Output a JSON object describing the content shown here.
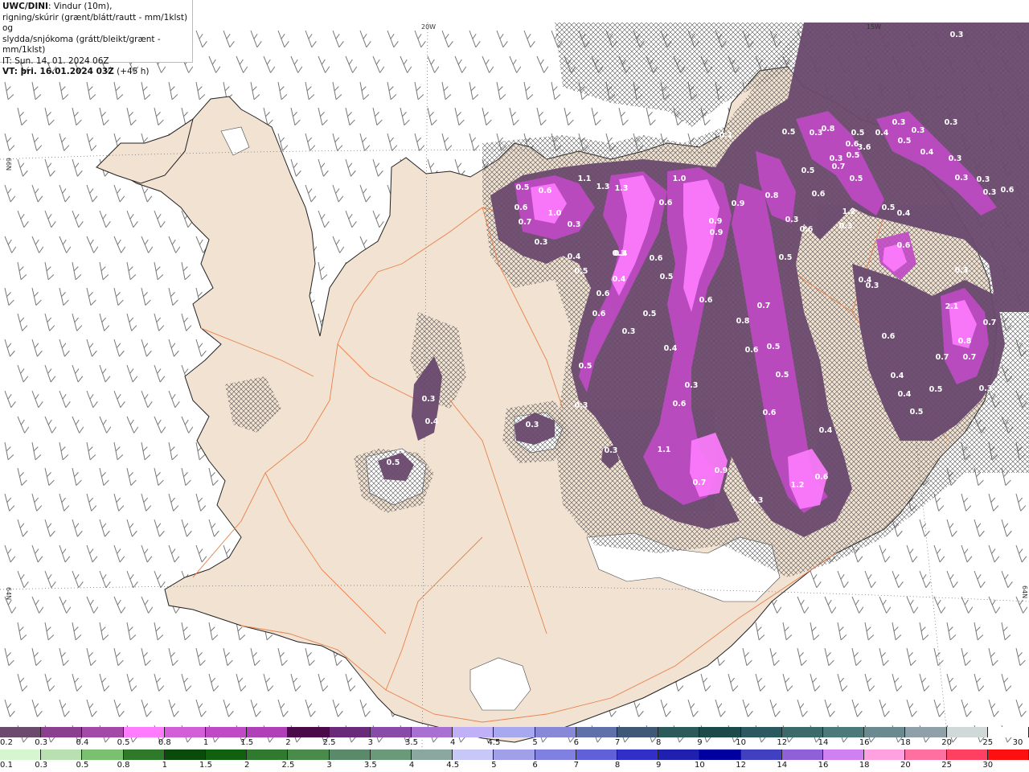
{
  "info": {
    "title_bold": "UWC/DINI",
    "title_rest": ": Vindur (10m),",
    "line2": "rigning/skúrir (grænt/blátt/rautt - mm/1klst) og",
    "line3": "slydda/snjókoma (grátt/bleikt/grænt - mm/1klst)",
    "it_line": "IT: Sun. 14. 01. 2024 06Z",
    "vt_label": "VT",
    "vt_value": ": þri. 16.01.2024 03Z",
    "vt_offset": " (+45 h)"
  },
  "grid_labels": {
    "lon_20w": "20W",
    "lon_15w": "15W",
    "lat_66n_left": "66N",
    "lat_64n_left": "64N",
    "lat_64n_right": "64N"
  },
  "snow_values": [
    {
      "v": "0.3"
    },
    {
      "v": "0.4"
    },
    {
      "v": "0.3"
    },
    {
      "v": "0.5"
    },
    {
      "v": "0.3"
    },
    {
      "v": "0.5"
    },
    {
      "v": "0.4"
    },
    {
      "v": "0.3"
    },
    {
      "v": "0.5"
    },
    {
      "v": "0.6"
    },
    {
      "v": "0.6"
    },
    {
      "v": "1.0"
    },
    {
      "v": "0.7"
    },
    {
      "v": "0.3"
    },
    {
      "v": "0.3"
    },
    {
      "v": "0.5"
    },
    {
      "v": "0.3"
    },
    {
      "v": "1.1"
    },
    {
      "v": "1.3"
    },
    {
      "v": "1.3"
    },
    {
      "v": "1.0"
    },
    {
      "v": "0.6"
    },
    {
      "v": "0.9"
    },
    {
      "v": "0.9"
    },
    {
      "v": "0.4"
    },
    {
      "v": "0.4"
    },
    {
      "v": "0.6"
    },
    {
      "v": "0.6"
    },
    {
      "v": "0.5"
    },
    {
      "v": "0.6"
    },
    {
      "v": "0.3"
    },
    {
      "v": "0.5"
    },
    {
      "v": "0.4"
    },
    {
      "v": "0.6"
    },
    {
      "v": "0.6"
    },
    {
      "v": "0.8"
    },
    {
      "v": "0.6"
    },
    {
      "v": "0.5"
    },
    {
      "v": "0.7"
    },
    {
      "v": "0.5"
    },
    {
      "v": "0.3"
    },
    {
      "v": "1.1"
    },
    {
      "v": "0.7"
    },
    {
      "v": "0.9"
    },
    {
      "v": "0.3"
    },
    {
      "v": "0.6"
    },
    {
      "v": "0.4"
    },
    {
      "v": "1.2"
    },
    {
      "v": "0.6"
    },
    {
      "v": "0.9"
    },
    {
      "v": "0.8"
    },
    {
      "v": "0.3"
    },
    {
      "v": "0.5"
    },
    {
      "v": "0.5"
    },
    {
      "v": "0.6"
    },
    {
      "v": "0.6"
    },
    {
      "v": "1.2"
    },
    {
      "v": "0.3"
    },
    {
      "v": "0.5"
    },
    {
      "v": "0.6"
    },
    {
      "v": "0.5"
    },
    {
      "v": "0.4"
    },
    {
      "v": "0.3"
    },
    {
      "v": "0.5"
    },
    {
      "v": "3.6"
    },
    {
      "v": "0.5"
    },
    {
      "v": "0.4"
    },
    {
      "v": "0.4"
    },
    {
      "v": "0.3"
    },
    {
      "v": "0.3"
    },
    {
      "v": "0.3"
    },
    {
      "v": "0.3"
    },
    {
      "v": "0.3"
    },
    {
      "v": "0.3"
    },
    {
      "v": "0.6"
    },
    {
      "v": "0.1"
    },
    {
      "v": "0.3"
    },
    {
      "v": "2.1"
    },
    {
      "v": "0.8"
    },
    {
      "v": "0.7"
    },
    {
      "v": "0.7"
    },
    {
      "v": "0.7"
    },
    {
      "v": "0.6"
    },
    {
      "v": "0.4"
    },
    {
      "v": "0.4"
    },
    {
      "v": "0.5"
    },
    {
      "v": "0.5"
    },
    {
      "v": "0.3"
    },
    {
      "v": "0.3"
    },
    {
      "v": "0.3"
    },
    {
      "v": "0.3"
    },
    {
      "v": "0.3"
    },
    {
      "v": "0.7"
    },
    {
      "v": "0.5"
    },
    {
      "v": "0.8"
    },
    {
      "v": "0.4"
    },
    {
      "v": "0.6"
    },
    {
      "v": "0.5"
    }
  ],
  "legend_snow": {
    "colors": [
      "#6b4a6e",
      "#8a3f8f",
      "#a34aa8",
      "#ff7cff",
      "#d25fd7",
      "#c04ac6",
      "#b040b8",
      "#4a0a4a",
      "#6a2a7a",
      "#8a4aa8",
      "#a870d0",
      "#c0b0f8",
      "#a8a8f0",
      "#8888d8",
      "#6070a8",
      "#405878",
      "#2a5a5a",
      "#1a4a4a",
      "#2a5a60",
      "#3a6a6a",
      "#4a7a7a",
      "#6a8a90",
      "#90a0a8",
      "#d0d8d8",
      "#ffffff"
    ],
    "labels": [
      "0.2",
      "0.3",
      "0.4",
      "0.5",
      "0.8",
      "1",
      "1.5",
      "2",
      "2.5",
      "3",
      "3.5",
      "4",
      "4.5",
      "5",
      "6",
      "7",
      "8",
      "9",
      "10",
      "12",
      "14",
      "16",
      "18",
      "20",
      "25",
      "30"
    ]
  },
  "legend_rain": {
    "colors": [
      "#d6f6d0",
      "#b8e0b0",
      "#7ac070",
      "#2e7a2a",
      "#0a4a0a",
      "#106010",
      "#307a30",
      "#4a8a4a",
      "#5a8a6a",
      "#6a9a7a",
      "#8aa8a0",
      "#c8c8f8",
      "#a0a0e8",
      "#8080e0",
      "#6060d8",
      "#3030c8",
      "#2020b0",
      "#0000a0",
      "#4040c0",
      "#9060d8",
      "#d080f0",
      "#ffa0e0",
      "#ff70a0",
      "#ff4060",
      "#ff1010"
    ],
    "labels": [
      "0.1",
      "0.3",
      "0.5",
      "0.8",
      "1",
      "1.5",
      "2",
      "2.5",
      "3",
      "3.5",
      "4",
      "4.5",
      "5",
      "6",
      "7",
      "8",
      "9",
      "10",
      "12",
      "14",
      "16",
      "18",
      "20",
      "25",
      "30"
    ]
  }
}
